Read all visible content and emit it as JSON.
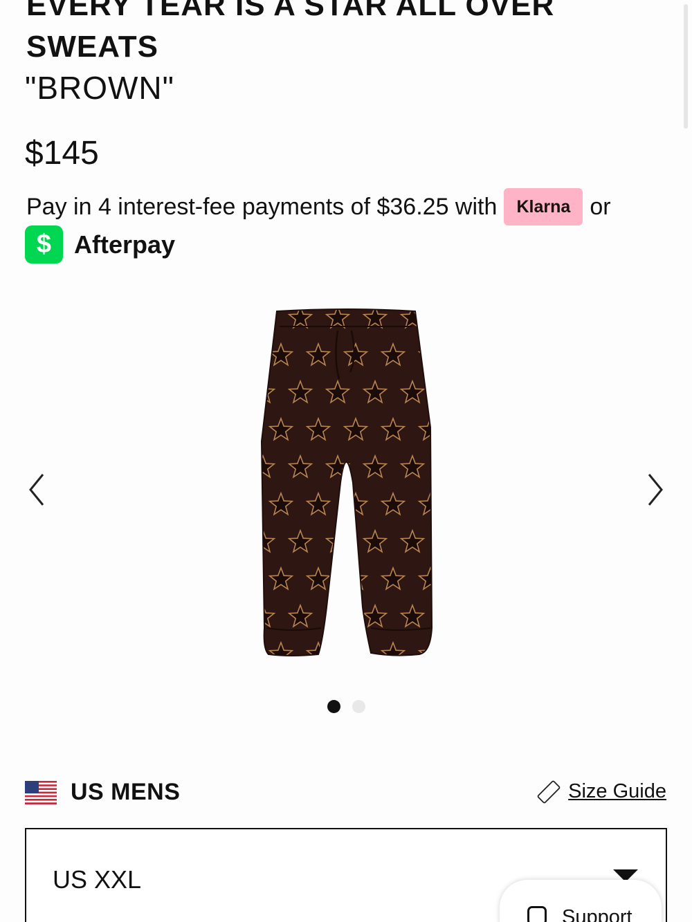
{
  "product": {
    "title_line1": "EVERY TEAR IS A STAR ALL OVER",
    "title_line2": "SWEATS",
    "color": "\"BROWN\"",
    "price": "$145"
  },
  "payment": {
    "text": "Pay in 4 interest-fee payments of $36.25 with",
    "klarna_label": "Klarna",
    "or": "or",
    "cash_symbol": "$",
    "afterpay_label": "Afterpay",
    "klarna_color": "#ffb3c7",
    "cashapp_color": "#00d64f"
  },
  "gallery": {
    "image_subject": "brown star all-over sweatpants",
    "prev_icon": "chevron-left-icon",
    "next_icon": "chevron-right-icon",
    "slide_count": 2,
    "active_slide": 1,
    "pants_color": "#2e1612",
    "star_color": "#b98552"
  },
  "size": {
    "region_label": "US MENS",
    "flag_icon": "us-flag-icon",
    "size_guide_label": "Size Guide",
    "size_guide_icon": "ruler-icon",
    "selected": "US XXL"
  },
  "support": {
    "label": "Support",
    "icon": "chat-bubble-icon"
  }
}
